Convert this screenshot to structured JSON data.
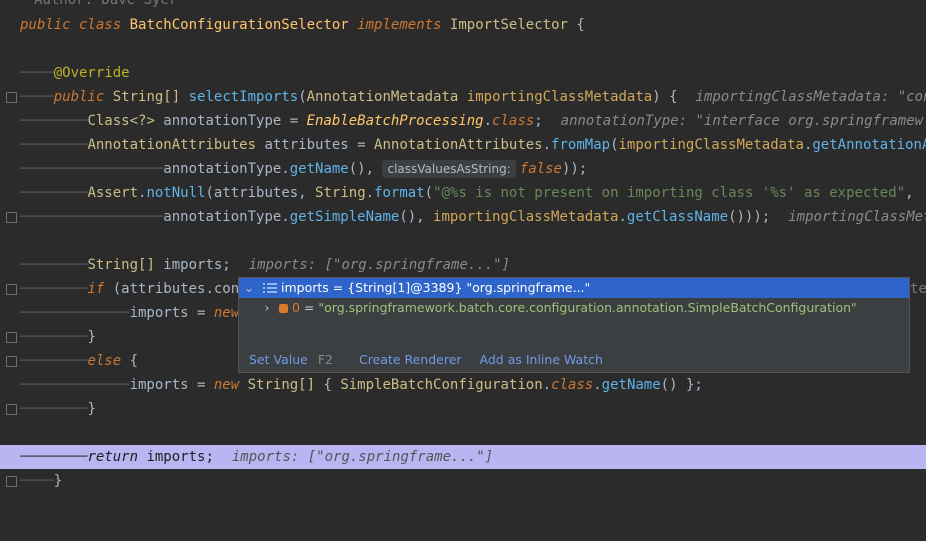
{
  "lines": {
    "l0": "Author: Dave Syer",
    "l1_kw1": "public class",
    "l1_cls": "BatchConfigurationSelector",
    "l1_kw2": "implements",
    "l1_type": "ImportSelector",
    "l1_brace": "{",
    "l3_ann": "@Override",
    "l4_kw": "public",
    "l4_type": "String[]",
    "l4_meth": "selectImports",
    "l4_open": "(",
    "l4_ptype": "AnnotationMetadata",
    "l4_param": "importingClassMetadata",
    "l4_close": ") {",
    "l4_inl": "importingClassMetadata: \"con",
    "l5_type": "Class<?>",
    "l5_var": " annotationType = ",
    "l5_cls": "EnableBatchProcessing",
    "l5_dot": ".",
    "l5_kw": "class",
    "l5_semi": ";",
    "l5_inl": "annotationType: \"interface org.springframew",
    "l6_type": "AnnotationAttributes",
    "l6_var": " attributes = ",
    "l6_type2": "AnnotationAttributes",
    "l6_dot": ".",
    "l6_meth": "fromMap",
    "l6_open": "(",
    "l6_param": "importingClassMetadata",
    "l6_dot2": ".",
    "l6_meth2": "getAnnotationA",
    "l7_var": "annotationType.",
    "l7_meth": "getName",
    "l7_paren": "(), ",
    "l7_hint": "classValuesAsString:",
    "l7_kw": "false",
    "l7_end": "));",
    "l8_type": "Assert",
    "l8_dot": ".",
    "l8_meth": "notNull",
    "l8_args": "(attributes, ",
    "l8_type2": "String",
    "l8_dot2": ".",
    "l8_meth2": "format",
    "l8_open": "(",
    "l8_str": "\"@%s is not present on importing class '%s' as expected\"",
    "l8_comma": ",",
    "l9_var": "annotationType.",
    "l9_meth": "getSimpleName",
    "l9_mid": "(), ",
    "l9_param": "importingClassMetadata",
    "l9_dot": ".",
    "l9_meth2": "getClassName",
    "l9_end": "()));",
    "l9_inl": "importingClassMeta",
    "l11_type": "String[]",
    "l11_var": " imports;",
    "l11_inl": "imports: [\"org.springframe...\"]",
    "l12_kw": "if",
    "l12_rest": " (attributes.con",
    "l12_tail": "te",
    "l13_var": "imports = ",
    "l13_kw": "new",
    "l14_brace": "}",
    "l15_kw": "else",
    "l15_brace": " {",
    "l16_var": "imports = ",
    "l16_kw": "new",
    "l16_type": " String[]",
    "l16_open": " { ",
    "l16_cls": "SimpleBatchConfiguration",
    "l16_dot": ".",
    "l16_kw2": "class",
    "l16_dot2": ".",
    "l16_meth": "getName",
    "l16_end": "() };",
    "l17_brace": "}",
    "l19_kw": "return",
    "l19_var": " imports;",
    "l19_inl": "imports: [\"org.springframe...\"]",
    "l20_brace": "}"
  },
  "popup": {
    "root_label": "imports = {String[1]@3389} \"org.springframe...\"",
    "child_index": "0",
    "child_eq": " = ",
    "child_value": "\"org.springframework.batch.core.configuration.annotation.SimpleBatchConfiguration\"",
    "set_value": "Set Value",
    "set_value_key": "F2",
    "create_renderer": "Create Renderer",
    "add_inline_watch": "Add as Inline Watch"
  }
}
